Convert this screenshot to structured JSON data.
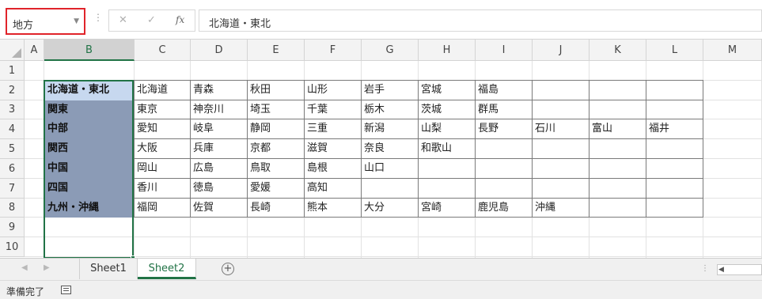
{
  "name_box": {
    "value": "地方"
  },
  "formula_bar": {
    "dots": "⋮",
    "cancel_glyph": "✕",
    "enter_glyph": "✓",
    "fx_label": "fx",
    "content": "北海道・東北"
  },
  "columns": [
    "A",
    "B",
    "C",
    "D",
    "E",
    "F",
    "G",
    "H",
    "I",
    "J",
    "K",
    "L",
    "M"
  ],
  "rows": [
    "1",
    "2",
    "3",
    "4",
    "5",
    "6",
    "7",
    "8",
    "9",
    "10"
  ],
  "regions": [
    "北海道・東北",
    "関東",
    "中部",
    "関西",
    "中国",
    "四国",
    "九州・沖縄"
  ],
  "prefectures": [
    [
      "北海道",
      "青森",
      "秋田",
      "山形",
      "岩手",
      "宮城",
      "福島"
    ],
    [
      "東京",
      "神奈川",
      "埼玉",
      "千葉",
      "栃木",
      "茨城",
      "群馬"
    ],
    [
      "愛知",
      "岐阜",
      "静岡",
      "三重",
      "新潟",
      "山梨",
      "長野",
      "石川",
      "富山",
      "福井"
    ],
    [
      "大阪",
      "兵庫",
      "京都",
      "滋賀",
      "奈良",
      "和歌山"
    ],
    [
      "岡山",
      "広島",
      "鳥取",
      "島根",
      "山口"
    ],
    [
      "香川",
      "徳島",
      "愛媛",
      "高知"
    ],
    [
      "福岡",
      "佐賀",
      "長崎",
      "熊本",
      "大分",
      "宮崎",
      "鹿児島",
      "沖縄"
    ]
  ],
  "sheet_tabs": {
    "sheet1": "Sheet1",
    "sheet2": "Sheet2",
    "add": "+"
  },
  "nav": {
    "prev": "◀",
    "next": "▶"
  },
  "status": {
    "text": "準備完了"
  },
  "colors": {
    "accent": "#217346",
    "name_box_border": "#e0242a",
    "selection": "#8b9bb6",
    "active_cell": "#c7d8ef"
  }
}
